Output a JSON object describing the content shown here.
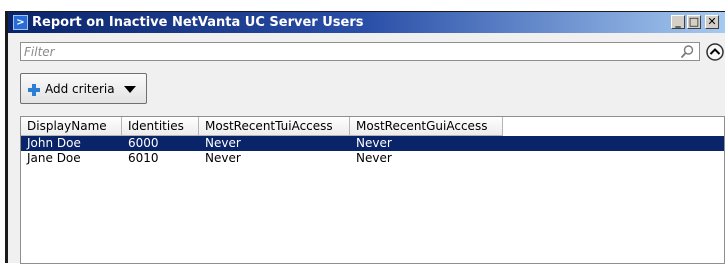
{
  "window": {
    "title": "Report on Inactive NetVanta UC Server Users",
    "buttons": {
      "minimize": "_",
      "maximize": "□",
      "close": "✕"
    }
  },
  "filter": {
    "placeholder": "Filter",
    "value": ""
  },
  "toolbar": {
    "add_criteria_label": "Add criteria"
  },
  "table": {
    "columns": [
      "DisplayName",
      "Identities",
      "MostRecentTuiAccess",
      "MostRecentGuiAccess"
    ],
    "rows": [
      {
        "DisplayName": "John Doe",
        "Identities": "6000",
        "MostRecentTuiAccess": "Never",
        "MostRecentGuiAccess": "Never",
        "selected": true
      },
      {
        "DisplayName": "Jane Doe",
        "Identities": "6010",
        "MostRecentTuiAccess": "Never",
        "MostRecentGuiAccess": "Never",
        "selected": false
      }
    ]
  },
  "colors": {
    "selection": "#0a246a",
    "titlebar_start": "#0a246a",
    "titlebar_end": "#a6caf0",
    "plus_icon": "#2a7fd4"
  }
}
